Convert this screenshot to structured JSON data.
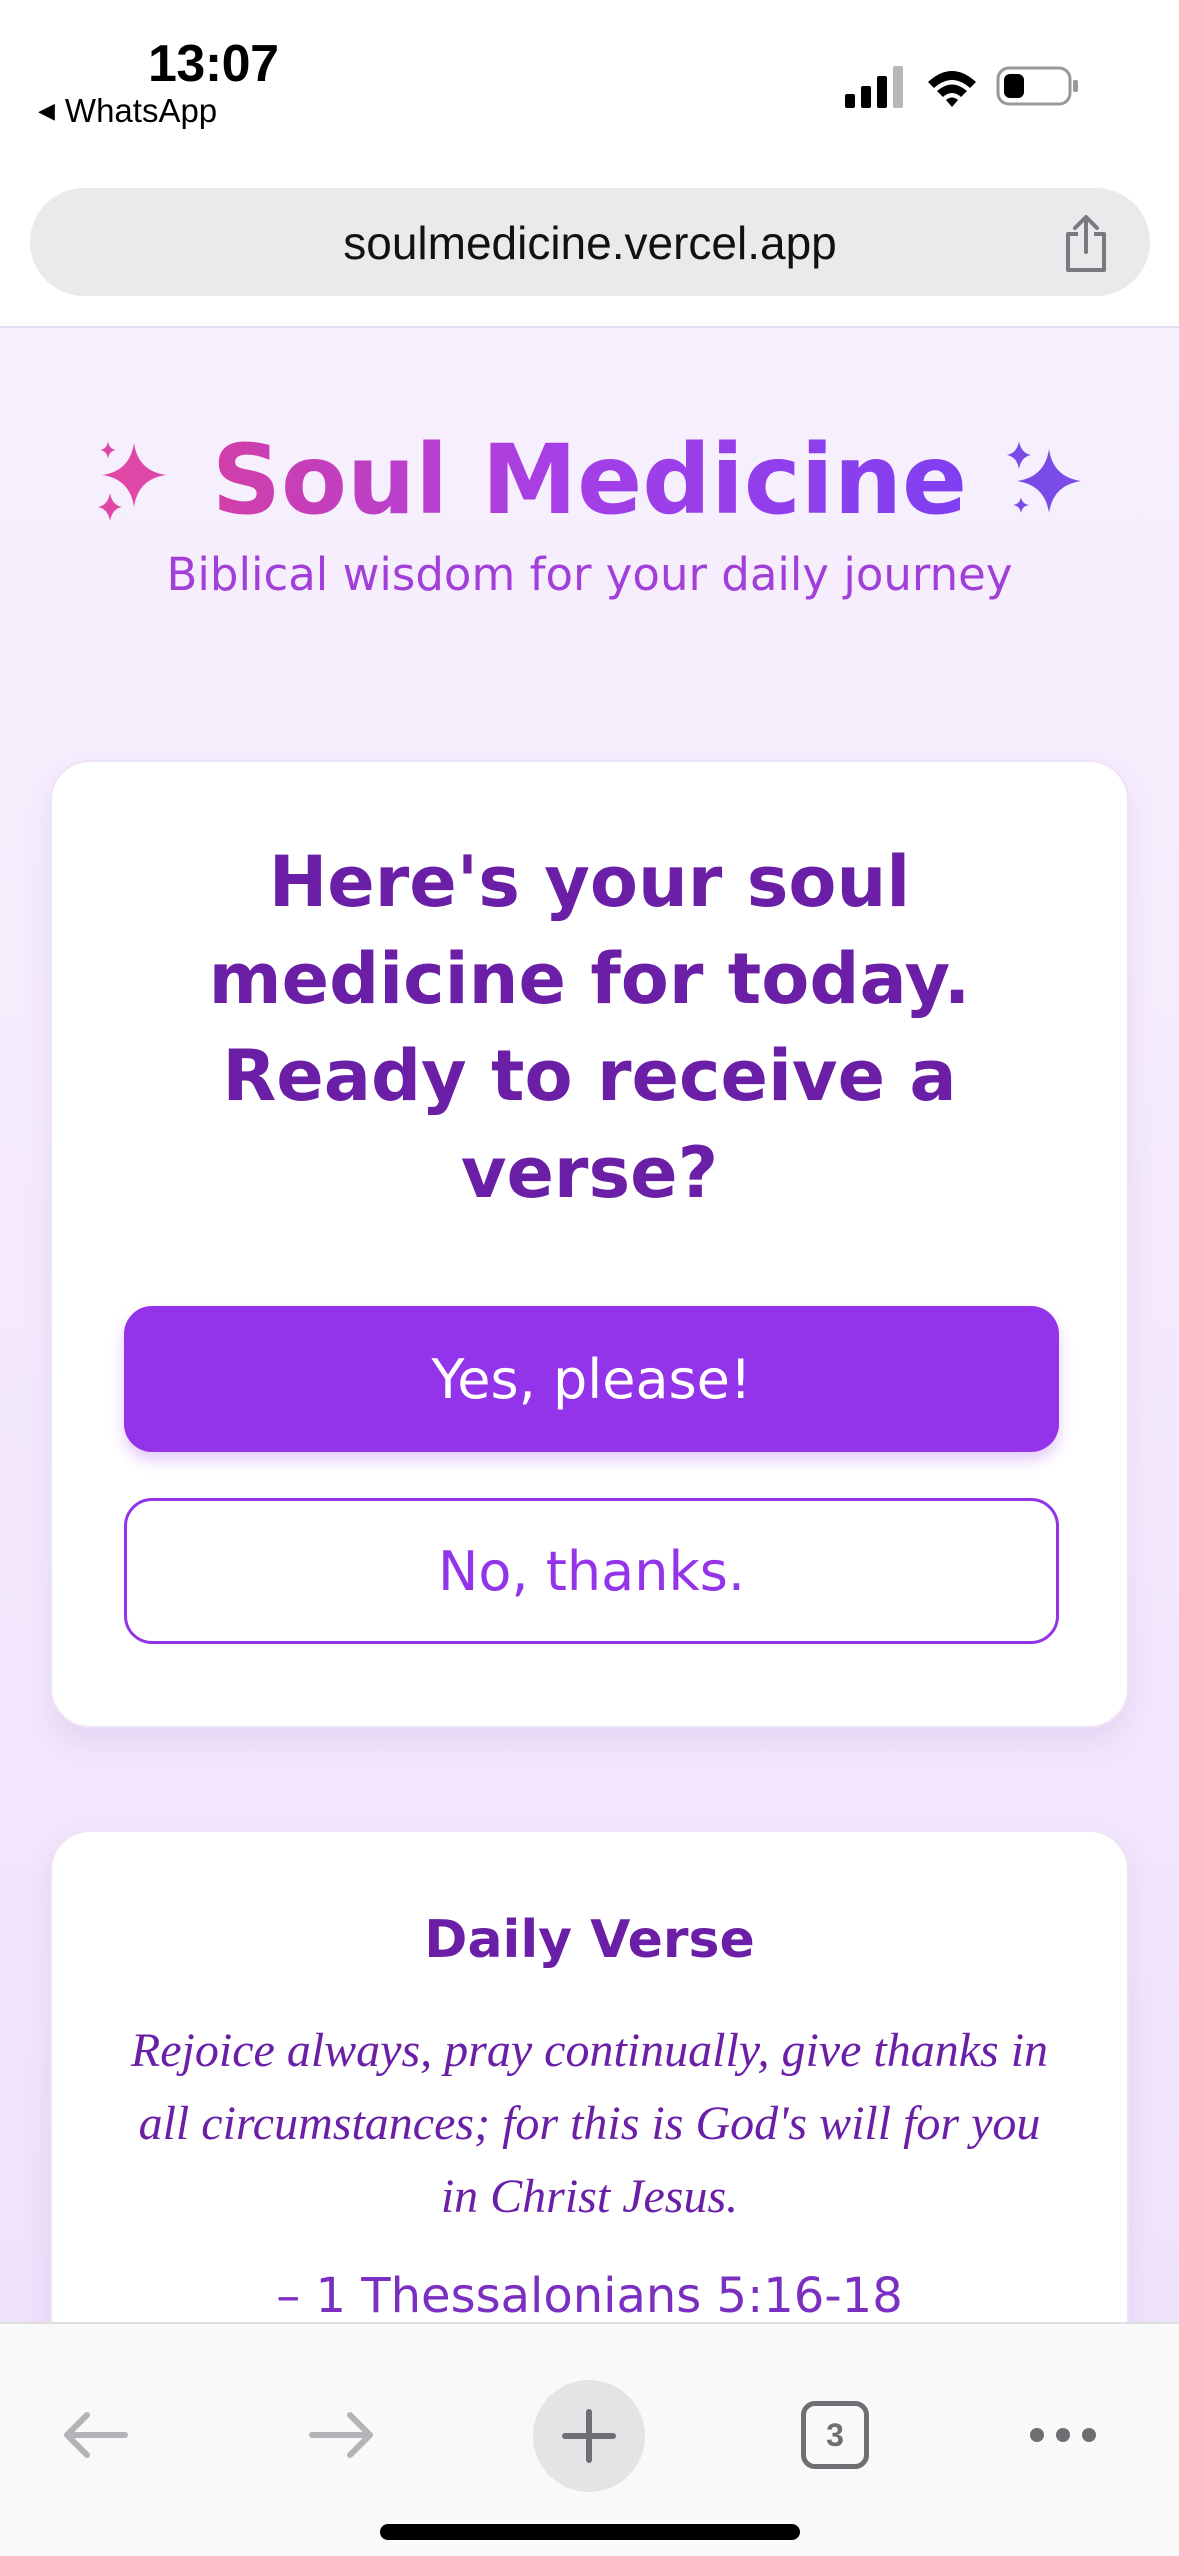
{
  "status_bar": {
    "time": "13:07",
    "back_app": "WhatsApp",
    "icons": [
      "cellular-signal-icon",
      "wifi-icon",
      "battery-icon"
    ]
  },
  "browser": {
    "url": "soulmedicine.vercel.app",
    "share_icon": "share-icon",
    "toolbar": {
      "items": [
        "back-arrow-icon",
        "forward-arrow-icon",
        "new-tab-plus-icon",
        "tabs-icon",
        "more-icon"
      ],
      "tab_count": "3"
    }
  },
  "page": {
    "title": "Soul Medicine",
    "title_icons": [
      "sparkles-icon",
      "sparkles-icon"
    ],
    "tagline": "Biblical wisdom for your daily journey",
    "prompt_card": {
      "question": "Here's your soul medicine for today. Ready to receive a verse?",
      "accept_label": "Yes, please!",
      "decline_label": "No, thanks."
    },
    "verse_card": {
      "heading": "Daily Verse",
      "text": "Rejoice always, pray continually, give thanks in all circumstances; for this is God's will for you in Christ Jesus.",
      "reference": "– 1 Thessalonians 5:16-18"
    }
  },
  "colors": {
    "accent": "#9333ea",
    "heading_purple": "#6a1fa6",
    "title_gradient_start": "#d23fa8",
    "title_gradient_end": "#7f3ff0",
    "page_background": "#f5ecfd"
  }
}
